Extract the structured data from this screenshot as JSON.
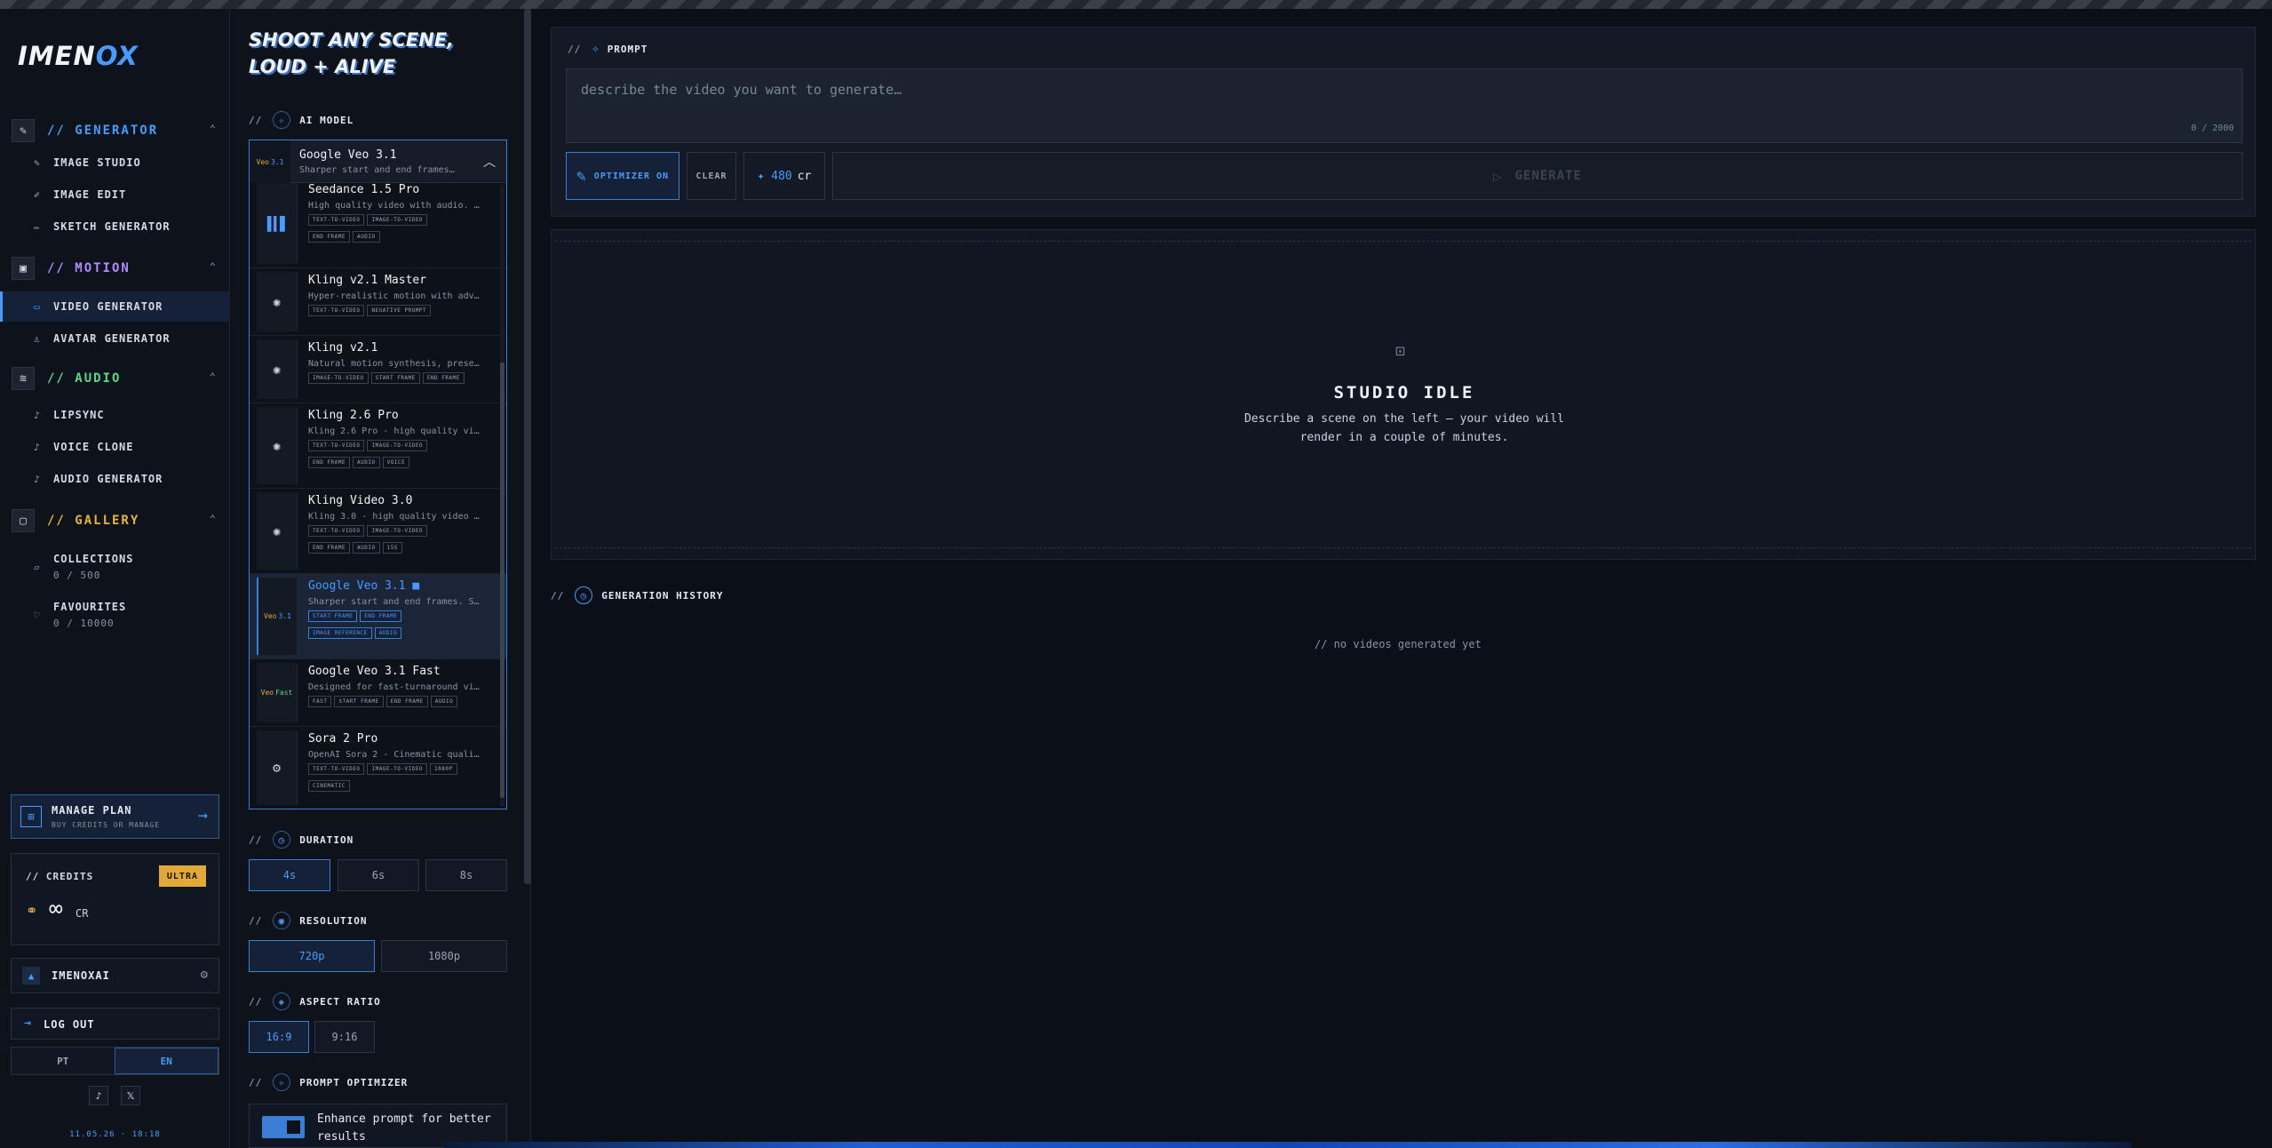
{
  "brand": {
    "name_a": "IMEN",
    "name_b": "OX"
  },
  "sidebar": {
    "sections": [
      {
        "title": "// GENERATOR",
        "icon": "wand-icon",
        "items": [
          {
            "label": "IMAGE STUDIO",
            "icon": "brush-icon"
          },
          {
            "label": "IMAGE EDIT",
            "icon": "pencil-icon"
          },
          {
            "label": "SKETCH GENERATOR",
            "icon": "sketch-icon"
          }
        ]
      },
      {
        "title": "// MOTION",
        "icon": "film-icon",
        "items": [
          {
            "label": "VIDEO GENERATOR",
            "icon": "video-icon"
          },
          {
            "label": "AVATAR GENERATOR",
            "icon": "user-icon"
          }
        ]
      },
      {
        "title": "// AUDIO",
        "icon": "waveform-icon",
        "items": [
          {
            "label": "LIPSYNC",
            "icon": "mic-icon"
          },
          {
            "label": "VOICE CLONE",
            "icon": "mic-icon"
          },
          {
            "label": "AUDIO GENERATOR",
            "icon": "mic-icon"
          }
        ]
      },
      {
        "title": "// GALLERY",
        "icon": "gallery-icon",
        "items": [
          {
            "label": "COLLECTIONS",
            "sub": "0 / 500",
            "icon": "folder-icon"
          },
          {
            "label": "FAVOURITES",
            "sub": "0 / 10000",
            "icon": "heart-icon"
          }
        ]
      }
    ],
    "plan": {
      "title": "MANAGE PLAN",
      "subtitle": "BUY CREDITS OR MANAGE"
    },
    "credits": {
      "label": "// CREDITS",
      "badge": "ULTRA",
      "value": "∞",
      "unit": "CR"
    },
    "user": {
      "name": "IMENOXAI"
    },
    "logout": "LOG OUT",
    "langs": [
      "PT",
      "EN"
    ],
    "social": [
      "♪",
      "𝕏"
    ],
    "clock": "11.05.26 · 18:18"
  },
  "middle": {
    "title": "SHOOT ANY SCENE, LOUD + ALIVE",
    "ai_model_label": "AI MODEL",
    "selected": {
      "name": "Google Veo 3.1",
      "desc": "Sharper start and end frames…"
    },
    "options": [
      {
        "name": "Seedance 1.5 Pro",
        "desc": "High quality video with audio. …",
        "tags": [
          "TEXT-TO-VIDEO",
          "IMAGE-TO-VIDEO",
          "END FRAME",
          "AUDIO"
        ]
      },
      {
        "name": "Kling v2.1 Master",
        "desc": "Hyper-realistic motion with adv…",
        "tags": [
          "TEXT-TO-VIDEO",
          "NEGATIVE PROMPT"
        ]
      },
      {
        "name": "Kling v2.1",
        "desc": "Natural motion synthesis, prese…",
        "tags": [
          "IMAGE-TO-VIDEO",
          "START FRAME",
          "END FRAME"
        ]
      },
      {
        "name": "Kling 2.6 Pro",
        "desc": "Kling 2.6 Pro - high quality vi…",
        "tags": [
          "TEXT-TO-VIDEO",
          "IMAGE-TO-VIDEO",
          "END FRAME",
          "AUDIO",
          "VOICE"
        ]
      },
      {
        "name": "Kling Video 3.0",
        "desc": "Kling 3.0 - high quality video …",
        "tags": [
          "TEXT-TO-VIDEO",
          "IMAGE-TO-VIDEO",
          "END FRAME",
          "AUDIO",
          "15S"
        ]
      },
      {
        "name": "Google Veo 3.1 ■",
        "desc": "Sharper start and end frames. S…",
        "tags": [
          "START FRAME",
          "END FRAME",
          "IMAGE REFERENCE",
          "AUDIO"
        ]
      },
      {
        "name": "Google Veo 3.1 Fast",
        "desc": "Designed for fast-turnaround vi…",
        "tags": [
          "FAST",
          "START FRAME",
          "END FRAME",
          "AUDIO"
        ]
      },
      {
        "name": "Sora 2 Pro",
        "desc": "OpenAI Sora 2 - Cinematic quali…",
        "tags": [
          "TEXT-TO-VIDEO",
          "IMAGE-TO-VIDEO",
          "1080P",
          "CINEMATIC"
        ]
      }
    ],
    "duration": {
      "label": "DURATION",
      "options": [
        "4s",
        "6s",
        "8s"
      ]
    },
    "resolution": {
      "label": "RESOLUTION",
      "options": [
        "720p",
        "1080p"
      ]
    },
    "aspect": {
      "label": "ASPECT RATIO",
      "options": [
        "16:9",
        "9:16"
      ]
    },
    "optimizer": {
      "label": "PROMPT OPTIMIZER",
      "text": "Enhance prompt for better results"
    }
  },
  "prompt": {
    "label": "PROMPT",
    "placeholder": "describe the video you want to generate…",
    "counter": "0 / 2000",
    "optimizer_btn": "OPTIMIZER ON",
    "clear_btn": "CLEAR",
    "cost_value": "✦ 480",
    "cost_unit": "cr",
    "generate_btn": "GENERATE"
  },
  "stage": {
    "title": "STUDIO IDLE",
    "text": "Describe a scene on the left — your video will render in a couple of minutes."
  },
  "history": {
    "label": "GENERATION HISTORY",
    "empty": "// no videos generated yet"
  },
  "colors": {
    "accent": "#4a9bff",
    "motion": "#b18bff",
    "audio": "#5ed48a",
    "gallery": "#e7b33d",
    "badge": "#e2a93a"
  }
}
